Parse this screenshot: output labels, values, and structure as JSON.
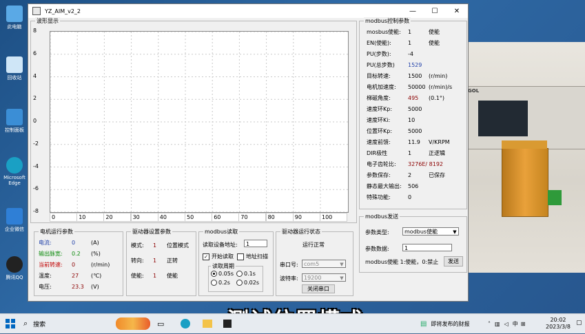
{
  "desktop": {
    "icons": [
      "此电脑",
      "回收站",
      "控制面板",
      "Microsoft Edge",
      "企业微信",
      "腾讯QQ"
    ]
  },
  "window": {
    "title": "YZ_AIM_v2_2",
    "controls": [
      "—",
      "☐",
      "✕"
    ]
  },
  "waveform": {
    "label": "波形显示",
    "y_ticks": [
      "8",
      "6",
      "4",
      "2",
      "0",
      "-2",
      "-4",
      "-6",
      "-8"
    ],
    "x_ticks": [
      "0",
      "10",
      "20",
      "30",
      "40",
      "50",
      "60",
      "70",
      "80",
      "90",
      "100"
    ],
    "ylim": [
      -8,
      8
    ],
    "xlim": [
      0,
      100
    ]
  },
  "modbus_params": {
    "label": "modbus控制参数",
    "rows": [
      {
        "k": "mosbus使能:",
        "v": "1",
        "u": "使能",
        "kc": ""
      },
      {
        "k": "EN(使能):",
        "v": "1",
        "u": "使能",
        "kc": ""
      },
      {
        "k": "PU(步数):",
        "v": "-4",
        "u": "",
        "kc": ""
      },
      {
        "k": "PU(总步数)",
        "v": "1529",
        "u": "",
        "kc": "",
        "vc": "blue"
      },
      {
        "k": "目标转速:",
        "v": "1500",
        "u": "(r/min)",
        "kc": ""
      },
      {
        "k": "电机加速度:",
        "v": "50000",
        "u": "(r/min)/s",
        "kc": ""
      },
      {
        "k": "梯磁角度:",
        "v": "495",
        "u": "(0.1°)",
        "kc": ""
      },
      {
        "k": "速度环Kp:",
        "v": "5000",
        "u": "",
        "kc": ""
      },
      {
        "k": "速度环Ki:",
        "v": "10",
        "u": "",
        "kc": ""
      },
      {
        "k": "位置环Kp:",
        "v": "5000",
        "u": "",
        "kc": ""
      },
      {
        "k": "速度前馈:",
        "v": "11.9",
        "u": "V/KRPM",
        "kc": ""
      },
      {
        "k": "DIR极性",
        "v": "1",
        "u": "正逻辑",
        "kc": ""
      },
      {
        "k": "电子齿轮比:",
        "v": "3276E/ 8192",
        "u": "",
        "kc": ""
      },
      {
        "k": "参数保存:",
        "v": "2",
        "u": "已保存",
        "kc": ""
      },
      {
        "k": "静态最大输出:",
        "v": "506",
        "u": "",
        "kc": ""
      },
      {
        "k": "特殊功能:",
        "v": "0",
        "u": "",
        "kc": ""
      }
    ]
  },
  "modbus_send": {
    "label": "modbus发送",
    "type_label": "参数类型:",
    "type_value": "modbus使能",
    "data_label": "参数数据:",
    "data_value": "1",
    "hint": "modbus使能 1:使能，0:禁止",
    "send_button": "发送"
  },
  "motor_params": {
    "label": "电机运行参数",
    "rows": [
      {
        "k": "电流:",
        "v": "0",
        "u": "(A)",
        "c": "blue"
      },
      {
        "k": "输出脉宽:",
        "v": "0.2",
        "u": "(%)",
        "c": "green2"
      },
      {
        "k": "当前转速:",
        "v": "0",
        "u": "(r/min)",
        "c": "red"
      },
      {
        "k": "温度:",
        "v": "27",
        "u": "(℃)",
        "c": ""
      },
      {
        "k": "电压:",
        "v": "23.3",
        "u": "(V)",
        "c": ""
      }
    ]
  },
  "driver_settings": {
    "label": "驱动器设置参数",
    "rows": [
      {
        "k": "模式:",
        "v": "1",
        "u": "位置模式"
      },
      {
        "k": "转向:",
        "v": "1",
        "u": "正转"
      },
      {
        "k": "使能:",
        "v": "1",
        "u": "使能"
      }
    ]
  },
  "modbus_read": {
    "label": "modbus读取",
    "addr_label": "读取设备地址:",
    "addr_value": "1",
    "start_read": "开始读取",
    "addr_scan": "地址扫描",
    "period_label": "读取周期",
    "periods": [
      "0.05s",
      "0.1s",
      "0.2s",
      "0.02s"
    ]
  },
  "driver_status": {
    "label": "驱动器运行状态",
    "status": "运行正常",
    "port_label": "串口号:",
    "port_value": "com5",
    "baud_label": "波特率:",
    "baud_value": "19200",
    "close_button": "关闭串口"
  },
  "caption": "测试位置模式",
  "taskbar": {
    "search": "搜索",
    "news": "即将发布的财报",
    "time": "20:02",
    "date": "2023/3/8",
    "ime": "中"
  },
  "photo": {
    "scope_brand": "RIGOL"
  }
}
